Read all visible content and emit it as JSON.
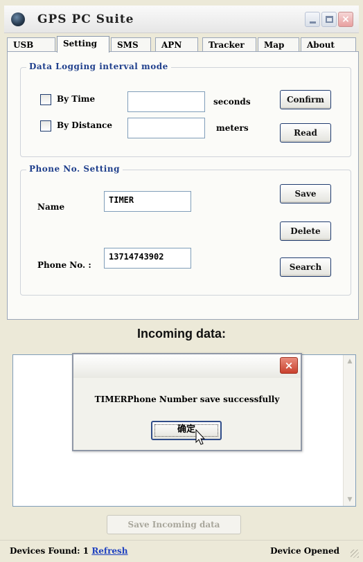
{
  "window": {
    "title": "GPS PC Suite",
    "icon": "globe-icon"
  },
  "tabs": [
    {
      "label": "USB"
    },
    {
      "label": "Setting"
    },
    {
      "label": "SMS"
    },
    {
      "label": "APN"
    },
    {
      "label": "Tracker"
    },
    {
      "label": "Map"
    },
    {
      "label": "About"
    }
  ],
  "active_tab": "Setting",
  "logging": {
    "title": "Data Logging interval mode",
    "by_time_label": "By Time",
    "by_time_value": "",
    "seconds_unit": "seconds",
    "by_distance_label": "By Distance",
    "by_distance_value": "",
    "meters_unit": "meters",
    "confirm_label": "Confirm",
    "read_label": "Read"
  },
  "phone": {
    "title": "Phone No. Setting",
    "name_label": "Name",
    "name_value": "TIMER",
    "phone_label": "Phone No. :",
    "phone_value": "13714743902",
    "save_label": "Save",
    "delete_label": "Delete",
    "search_label": "Search"
  },
  "incoming": {
    "title": "Incoming data:",
    "content": "",
    "save_label": "Save Incoming data"
  },
  "status": {
    "devices_found_label": "Devices Found: 1",
    "refresh_label": "Refresh",
    "device_state": "Device Opened"
  },
  "dialog": {
    "message": "TIMERPhone Number save successfully",
    "ok_label": "确定"
  }
}
